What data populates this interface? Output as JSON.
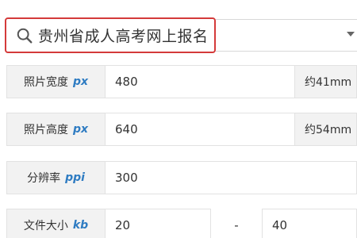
{
  "search": {
    "query": "贵州省成人高考网上报名",
    "icon": "search-icon",
    "highlight_color": "#d43a3a"
  },
  "form": {
    "unit_color": "#2f7cc2",
    "width": {
      "label": "照片宽度",
      "unit": "px",
      "value": "480",
      "approx": "约41mm"
    },
    "height": {
      "label": "照片高度",
      "unit": "px",
      "value": "640",
      "approx": "约54mm"
    },
    "resolution": {
      "label": "分辨率",
      "unit": "ppi",
      "value": "300"
    },
    "filesize": {
      "label": "文件大小",
      "unit": "kb",
      "min": "20",
      "separator": "-",
      "max": "40"
    }
  }
}
